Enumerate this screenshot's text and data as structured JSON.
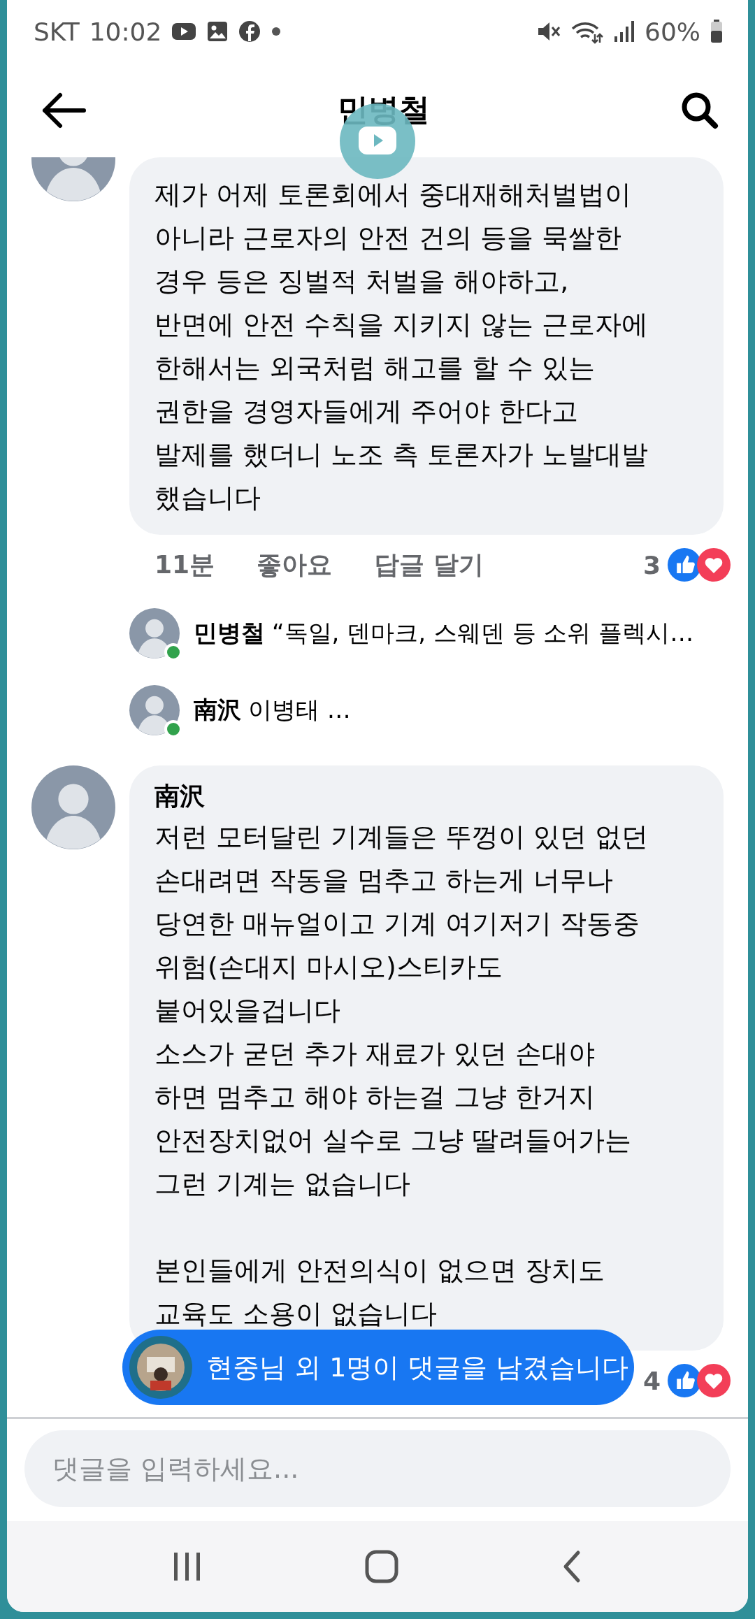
{
  "status_bar": {
    "carrier": "SKT",
    "time": "10:02",
    "battery": "60%"
  },
  "header": {
    "title": "민병철"
  },
  "comments": [
    {
      "paragraphs": [
        [
          "제가 어제 토론회에서 중대재해처벌법이",
          "아니라 근로자의 안전 건의 등을 묵쌀한",
          "경우 등은 징벌적 처벌을 해야하고,",
          "반면에 안전 수칙을 지키지 않는 근로자에",
          "한해서는 외국처럼 해고를 할 수 있는",
          "권한을 경영자들에게 주어야 한다고",
          "발제를 했더니 노조 측 토론자가 노발대발",
          "했습니다"
        ]
      ],
      "time": "11분",
      "like": "좋아요",
      "reply": "답글 달기",
      "reaction_count": "3",
      "replies": [
        {
          "name": "민병철",
          "text": "“독일, 덴마크, 스웨덴 등 소위 플렉시…",
          "online": true
        },
        {
          "name": "南沢",
          "text": "이병태 …",
          "online": true
        }
      ]
    },
    {
      "author": "南沢",
      "paragraphs": [
        [
          "저런 모터달린 기계들은 뚜껑이 있던 없던",
          "손대려면 작동을 멈추고 하는게 너무나",
          "당연한 매뉴얼이고 기계 여기저기 작동중",
          "위험(손대지 마시오)스티카도",
          "붙어있을겁니다",
          "소스가 굳던 추가 재료가 있던 손대야",
          "하면 멈추고 해야 하는걸 그냥 한거지",
          "안전장치없어 실수로 그냥 딸려들어가는",
          "그런 기계는 없습니다"
        ],
        [
          "본인들에게 안전의식이 없으면 장치도",
          "교육도 소용이 없습니다"
        ]
      ],
      "reaction_count": "4"
    }
  ],
  "notification": {
    "text": "현중님 외 1명이 댓글을 남겼습니다"
  },
  "input": {
    "placeholder": "댓글을 입력하세요..."
  }
}
